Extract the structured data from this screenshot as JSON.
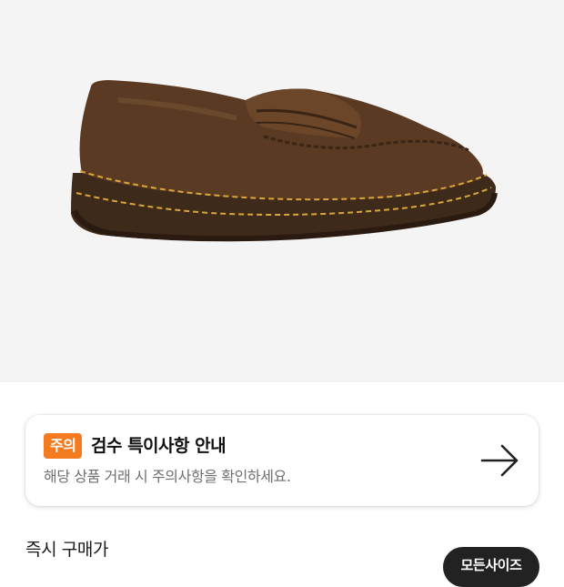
{
  "product": {
    "image_alt": "brown leather penny loafer"
  },
  "notice": {
    "badge": "주의",
    "title": "검수 특이사항 안내",
    "description": "해당 상품 거래 시 주의사항을 확인하세요.",
    "action_icon": "arrow-right-icon"
  },
  "purchase": {
    "label": "즉시 구매가",
    "size_button_label": "모든사이즈"
  },
  "colors": {
    "badge": "#f47b20",
    "hero_background": "#f4f4f4",
    "dark_button": "#222222"
  }
}
